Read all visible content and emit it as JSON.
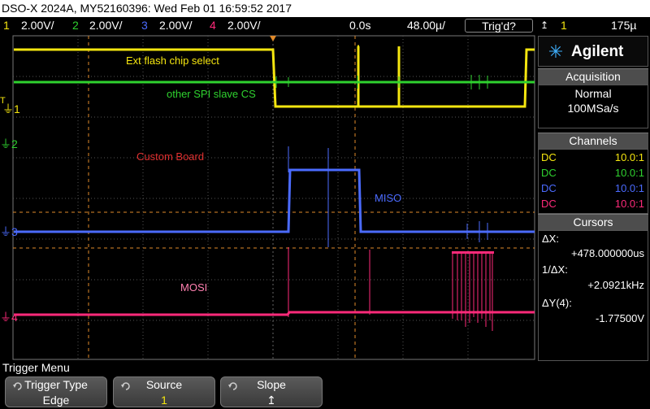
{
  "title": "DSO-X 2024A, MY52160396: Wed Feb 01 16:59:52 2017",
  "status": {
    "ch1": {
      "num": "1",
      "scale": "2.00V/",
      "color": "#f5e60f"
    },
    "ch2": {
      "num": "2",
      "scale": "2.00V/",
      "color": "#2fd22f"
    },
    "ch3": {
      "num": "3",
      "scale": "2.00V/",
      "color": "#4b6bff"
    },
    "ch4": {
      "num": "4",
      "scale": "2.00V/",
      "color": "#ff2a7a"
    },
    "time_offset": "0.0s",
    "time_scale": "48.00µ/",
    "trig_state": "Trig'd?",
    "trig_channel": "1",
    "trig_level": "175µ"
  },
  "annotations": {
    "ext_flash": "Ext flash chip select",
    "other_spi": "other SPI slave CS",
    "custom_board": "Custom Board",
    "miso": "MISO",
    "mosi": "MOSI"
  },
  "markers": {
    "t": "T",
    "ch1": "1",
    "ch2": "2",
    "ch3": "3",
    "ch4": "4"
  },
  "panel": {
    "brand": "Agilent",
    "acquisition": {
      "title": "Acquisition",
      "mode": "Normal",
      "rate": "100MSa/s"
    },
    "channels": {
      "title": "Channels",
      "rows": [
        {
          "coupling": "DC",
          "probe": "10.0:1",
          "color": "#f5e60f"
        },
        {
          "coupling": "DC",
          "probe": "10.0:1",
          "color": "#2fd22f"
        },
        {
          "coupling": "DC",
          "probe": "10.0:1",
          "color": "#4b6bff"
        },
        {
          "coupling": "DC",
          "probe": "10.0:1",
          "color": "#ff2a7a"
        }
      ]
    },
    "cursors": {
      "title": "Cursors",
      "dx_label": "ΔX:",
      "dx_value": "+478.000000us",
      "inv_label": "1/ΔX:",
      "inv_value": "+2.0921kHz",
      "dy_label": "ΔY(4):",
      "dy_value": "-1.77500V"
    }
  },
  "menu": {
    "title": "Trigger Menu",
    "keys": [
      {
        "label": "Trigger Type",
        "value": "Edge"
      },
      {
        "label": "Source",
        "value": "1"
      },
      {
        "label": "Slope",
        "value": "➤"
      }
    ]
  }
}
